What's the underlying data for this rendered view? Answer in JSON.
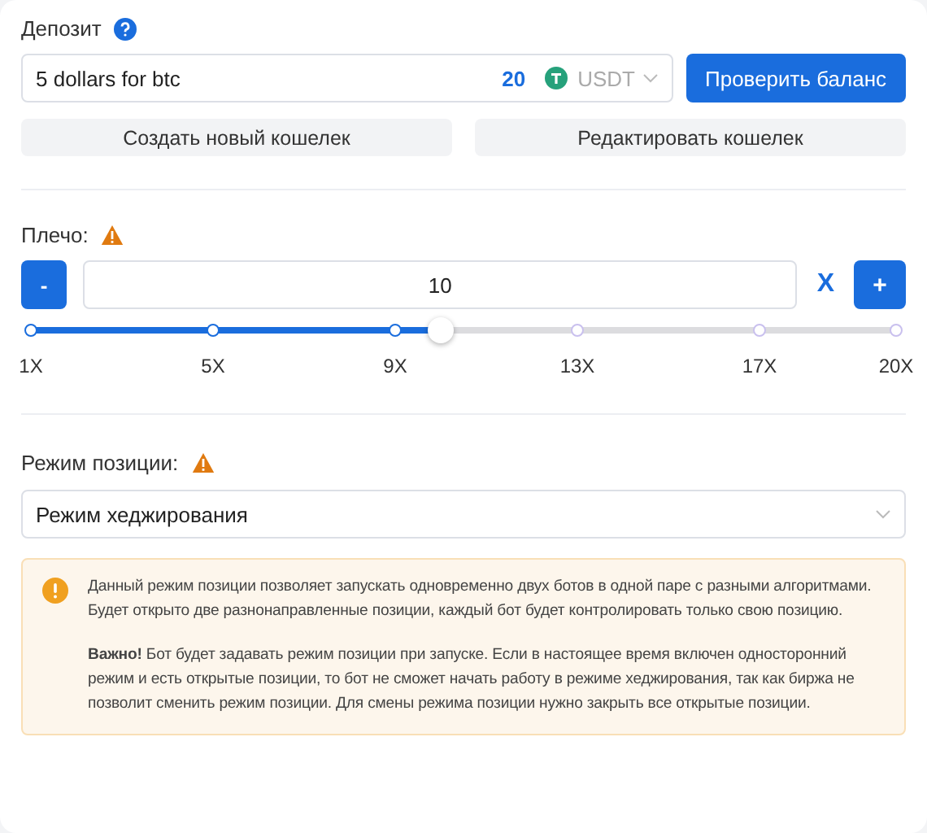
{
  "deposit": {
    "label": "Депозит",
    "wallet": "5 dollars for btc",
    "amount": "20",
    "currency": "USDT",
    "check_button": "Проверить баланс"
  },
  "wallet_buttons": [
    "Создать новый кошелек",
    "Редактировать кошелек"
  ],
  "leverage": {
    "label": "Плечо:",
    "minus": "-",
    "value": "10",
    "unit": "X",
    "plus": "+",
    "level": 0.4737,
    "marks": [
      "1X",
      "5X",
      "9X",
      "13X",
      "17X",
      "20X"
    ]
  },
  "position_mode": {
    "label": "Режим позиции:",
    "value": "Режим хеджирования"
  },
  "notice": {
    "paragraphs": [
      "Данный режим позиции позволяет запускать одновременно двух ботов в одной паре с разными алгоритмами. Будет открыто две разнонаправленные позиции, каждый бот будет контролировать только свою позицию.",
      "**Важно!** Бот будет задавать режим позиции при запуске. Если в настоящее время включен односторонний режим и есть открытые позиции, то бот не сможет начать работу в режиме хеджирования, так как биржа не позволит сменить режим позиции. Для смены режима позиции нужно закрыть все открытые позиции."
    ]
  }
}
